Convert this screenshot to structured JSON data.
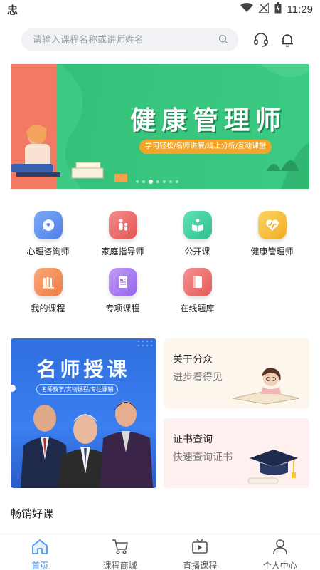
{
  "status_bar": {
    "app_glyph": "忠",
    "time": "11:29"
  },
  "search": {
    "placeholder": "请输入课程名称或讲师姓名"
  },
  "banner": {
    "title": "健康管理师",
    "subtitle": "学习轻松/名师讲解/线上分析/互动课堂",
    "dot_count": 7,
    "active_dot": 2
  },
  "categories": [
    {
      "label": "心理咨询师",
      "icon": "psych-chat-icon",
      "color": "#5b8ff0"
    },
    {
      "label": "家庭指导师",
      "icon": "family-icon",
      "color": "#ef6a6a"
    },
    {
      "label": "公开课",
      "icon": "open-book-icon",
      "color": "#3fcf9f"
    },
    {
      "label": "健康管理师",
      "icon": "heartbeat-icon",
      "color": "#f5c13f"
    },
    {
      "label": "我的课程",
      "icon": "my-courses-icon",
      "color": "#f2885a"
    },
    {
      "label": "专项课程",
      "icon": "document-icon",
      "color": "#a87cf0"
    },
    {
      "label": "在线题库",
      "icon": "question-bank-icon",
      "color": "#ef6f6f"
    }
  ],
  "promo": {
    "main_title": "名师授课",
    "main_subtitle": "名师教学/实物课程/专注课辅",
    "cards": [
      {
        "title": "关于分众",
        "subtitle": "进步看得见",
        "bg": "#fdf6ec"
      },
      {
        "title": "证书查询",
        "subtitle": "快速查询证书",
        "bg": "#fdf0ef"
      }
    ]
  },
  "section": {
    "title": "畅销好课"
  },
  "bottom_nav": [
    {
      "label": "首页",
      "icon": "home-icon",
      "active": true
    },
    {
      "label": "课程商城",
      "icon": "cart-icon",
      "active": false
    },
    {
      "label": "直播课程",
      "icon": "live-tv-icon",
      "active": false
    },
    {
      "label": "个人中心",
      "icon": "user-icon",
      "active": false
    }
  ],
  "colors": {
    "accent": "#3b8cf0",
    "banner_green": "#39c67f",
    "promo_blue": "#3b7ff0"
  }
}
